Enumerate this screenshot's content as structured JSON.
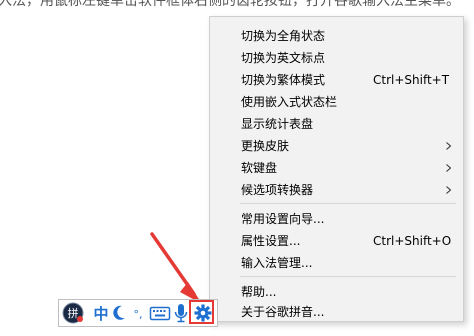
{
  "document": {
    "instruction_text": "入法，用鼠标左键单击软件框体右侧的齿轮按钮，打开谷歌输入法主菜单。"
  },
  "menu": {
    "items": [
      {
        "label": "切换为全角状态",
        "shortcut": "",
        "submenu": false
      },
      {
        "label": "切换为英文标点",
        "shortcut": "",
        "submenu": false
      },
      {
        "label": "切换为繁体模式",
        "shortcut": "Ctrl+Shift+T",
        "submenu": false
      },
      {
        "label": "使用嵌入式状态栏",
        "shortcut": "",
        "submenu": false
      },
      {
        "label": "显示统计表盘",
        "shortcut": "",
        "submenu": false
      },
      {
        "label": "更换皮肤",
        "shortcut": "",
        "submenu": true
      },
      {
        "label": "软键盘",
        "shortcut": "",
        "submenu": true
      },
      {
        "label": "候选项转换器",
        "shortcut": "",
        "submenu": true
      },
      {
        "label": "常用设置向导...",
        "shortcut": "",
        "submenu": false
      },
      {
        "label": "属性设置...",
        "shortcut": "Ctrl+Shift+O",
        "submenu": false
      },
      {
        "label": "输入法管理...",
        "shortcut": "",
        "submenu": false
      },
      {
        "label": "帮助...",
        "shortcut": "",
        "submenu": false
      },
      {
        "label": "关于谷歌拼音...",
        "shortcut": "",
        "submenu": false
      }
    ]
  },
  "toolbar": {
    "logo_char": "拼",
    "mode_char": "中",
    "punct_char": "°,",
    "icons": [
      "ime-logo-icon",
      "chinese-mode-icon",
      "half-width-moon-icon",
      "punctuation-icon",
      "soft-keyboard-icon",
      "microphone-icon",
      "gear-icon"
    ]
  },
  "colors": {
    "menu_bg": "#f2f2f2",
    "toolbar_blue": "#1e6fd0",
    "annotation_red": "#e53935",
    "logo_dark": "#1a2a44"
  }
}
